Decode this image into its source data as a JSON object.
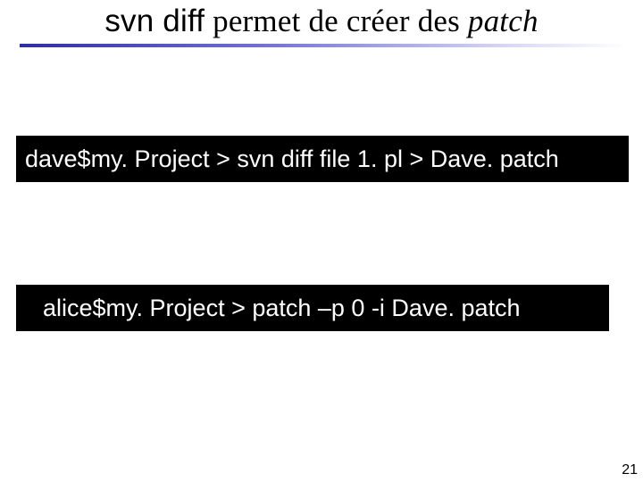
{
  "title": {
    "command": "svn diff",
    "middle": " permet de créer des ",
    "emph": "patch"
  },
  "code": {
    "line1": "dave$my. Project > svn diff file 1. pl > Dave. patch",
    "line2": "alice$my. Project > patch –p 0 -i Dave. patch"
  },
  "page_number": "21"
}
